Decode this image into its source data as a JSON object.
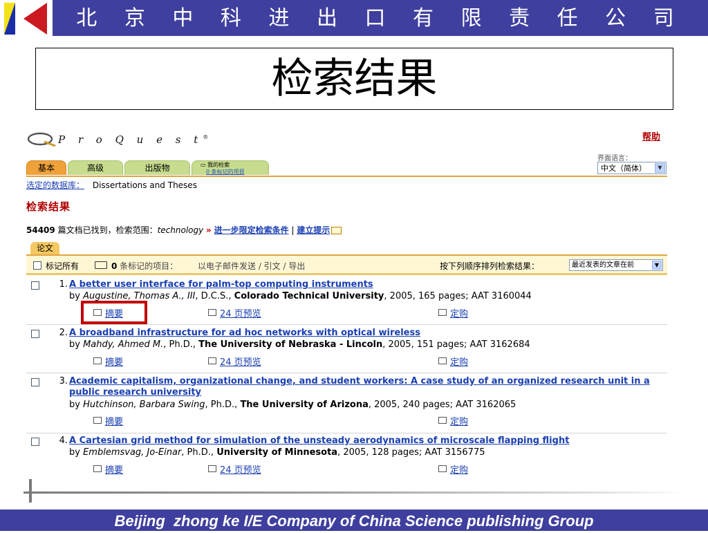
{
  "banner": {
    "company_name": "北 京 中 科 进 出 口 有 限 责 任 公 司"
  },
  "slide_title": "检索结果",
  "proquest": {
    "logo_text": "P r o Q u e s t",
    "registered_mark": "®",
    "help_label": "帮助",
    "ui_language_label": "界面语言：",
    "ui_language_value": "中文（简体）",
    "tabs": [
      {
        "label": "基本",
        "active": true
      },
      {
        "label": "高级",
        "active": false
      },
      {
        "label": "出版物",
        "active": false
      },
      {
        "label": "我的检索",
        "sub": "0 条标记的项目",
        "active": false
      }
    ],
    "selected_db_label": "选定的数据库：",
    "selected_db_value": "Dissertations and Theses",
    "results_heading": "检索结果",
    "summary": {
      "count": "54409",
      "text": " 篇文档已找到，检索范围：",
      "query": "technology",
      "refine_arrow": "»",
      "refine_label": "进一步限定检索条件",
      "separator": "|",
      "alert_label": "建立提示"
    },
    "type_tab": "论文",
    "toolbar": {
      "mark_all": "标记所有",
      "marked_count": "0",
      "marked_text": " 条标记的项目：",
      "email_actions": "以电子邮件发送  / 引文  / 导出",
      "sort_label": "按下列顺序排列检索结果：",
      "sort_value": "最近发表的文章在前"
    },
    "results": [
      {
        "num": "1.",
        "title": "A better user interface for palm-top computing instruments",
        "by": "by ",
        "author": "Augustine, Thomas A., III",
        "degree": ", D.C.S., ",
        "school": "Colorado Technical University",
        "details": ", 2005, 165 pages; AAT 3160044",
        "abstract_label": "摘要",
        "preview_label": "24 页预览",
        "order_label": "定购"
      },
      {
        "num": "2.",
        "title": "A broadband infrastructure for ad hoc networks with optical wireless",
        "by": "by ",
        "author": "Mahdy, Ahmed M.",
        "degree": ", Ph.D., ",
        "school": "The University of Nebraska - Lincoln",
        "details": ", 2005, 151 pages; AAT 3162684",
        "abstract_label": "摘要",
        "preview_label": "24 页预览",
        "order_label": "定购"
      },
      {
        "num": "3.",
        "title": "Academic capitalism, organizational change, and student workers: A case study of an organized research unit in a public research university",
        "by": "by ",
        "author": "Hutchinson, Barbara Swing",
        "degree": ", Ph.D., ",
        "school": "The University of Arizona",
        "details": ", 2005, 240 pages; AAT 3162065",
        "abstract_label": "摘要",
        "order_label": "定购"
      },
      {
        "num": "4.",
        "title": "A Cartesian grid method for simulation of the unsteady aerodynamics of microscale flapping flight",
        "by": "by ",
        "author": "Emblemsvag, Jo-Einar",
        "degree": ", Ph.D., ",
        "school": "University of Minnesota",
        "details": ", 2005, 128 pages; AAT 3156775",
        "abstract_label": "摘要",
        "preview_label": "24 页预览",
        "order_label": "定购"
      }
    ]
  },
  "footer": "Beijing  zhong ke I/E Company of China Science publishing Group",
  "colors": {
    "banner": "#3f3f9f",
    "highlight": "#c00000",
    "tab_active": "#f0a23a",
    "tab": "#c7dc8e",
    "link": "#1a3fb0"
  }
}
